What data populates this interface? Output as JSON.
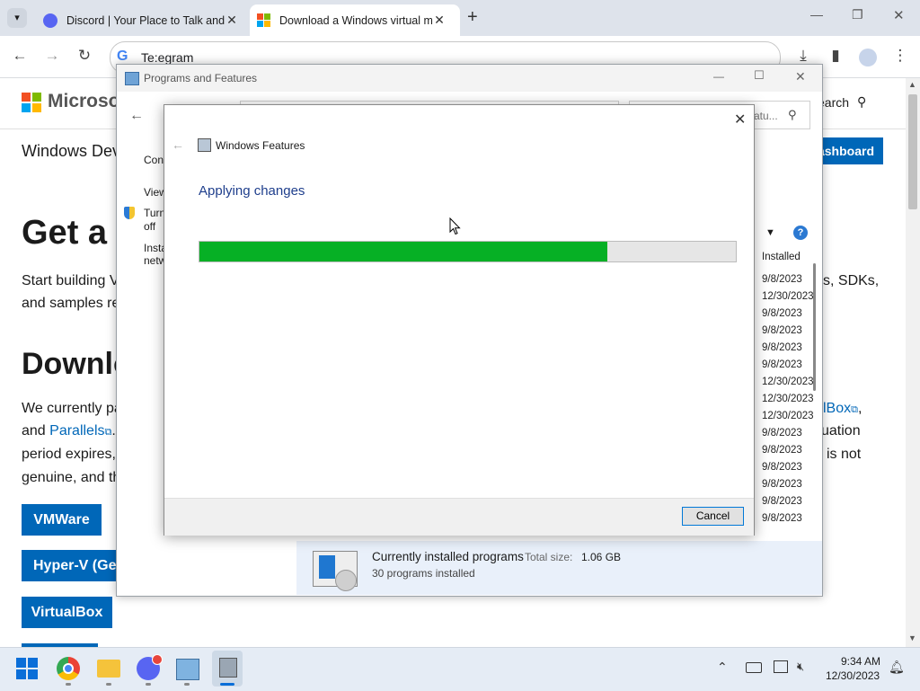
{
  "browser": {
    "tabs": [
      {
        "title": "Discord | Your Place to Talk and",
        "icon": "discord-icon",
        "active": false
      },
      {
        "title": "Download a Windows virtual m",
        "icon": "microsoft-icon",
        "active": true
      }
    ],
    "omnibox_value": "Te:egram"
  },
  "page": {
    "brand": "Microsoft",
    "search_label": "earch",
    "nav_title": "Windows Dev",
    "dashboard_btn": "ashboard",
    "h1": "Get a",
    "intro_l1": "Start building V",
    "intro_l1_right": "s, SDKs,",
    "intro_l2": "and samples re",
    "h2": "Downlo",
    "p_l1": "We currently pa",
    "p_l1_right": "lBox",
    "p_l1_tail": ",",
    "p_l2_a": "and ",
    "p_l2_link": "Parallels",
    "p_l2_tail": ".",
    "p_l2_right": "uation",
    "p_l3": "period expires,",
    "p_l3_right": "is not",
    "p_l4": "genuine, and th",
    "buttons": [
      "VMWare",
      "Hyper-V (Ger",
      "VirtualBox"
    ]
  },
  "control_panel": {
    "title": "Programs and Features",
    "search_placeholder": "atu...",
    "side": {
      "l1": "Cont",
      "l2": "View",
      "l3a": "Turn",
      "l3b": "off",
      "l4a": "Insta",
      "l4b": "netw"
    },
    "installed_header": "Installed",
    "dates": [
      "9/8/2023",
      "12/30/2023",
      "9/8/2023",
      "9/8/2023",
      "9/8/2023",
      "9/8/2023",
      "12/30/2023",
      "12/30/2023",
      "12/30/2023",
      "9/8/2023",
      "9/8/2023",
      "9/8/2023",
      "9/8/2023",
      "9/8/2023",
      "9/8/2023"
    ],
    "footer_title": "Currently installed programs",
    "footer_size_label": "Total size:",
    "footer_size_value": "1.06 GB",
    "footer_count": "30 programs installed"
  },
  "dialog": {
    "title": "Windows Features",
    "heading": "Applying changes",
    "progress": 0.76,
    "progress_color": "#06b025",
    "cancel_label": "Cancel"
  },
  "taskbar": {
    "apps": [
      "windows-start-icon",
      "chrome-icon",
      "file-explorer-icon",
      "discord-icon",
      "control-panel-icon",
      "windows-features-icon"
    ],
    "time": "9:34 AM",
    "date": "12/30/2023"
  }
}
